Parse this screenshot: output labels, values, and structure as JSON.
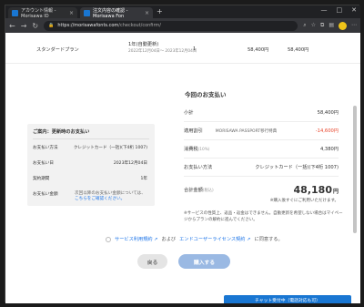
{
  "browser": {
    "tabs": [
      {
        "label": "アカウント情報 - Morisawa ID",
        "close": "×"
      },
      {
        "label": "注文内容の確認 - Morisawa Fon",
        "close": "×"
      }
    ],
    "new_tab": "+",
    "window_controls": [
      "—",
      "□",
      "✕"
    ],
    "url_host": "https://morisawafonts.com",
    "url_path": "/checkout/confirm/"
  },
  "plan_row": {
    "name": "スタンダードプラン",
    "duration": "1年(自動更新)",
    "dates": "2022年12月04日〜 2023年12月04日",
    "quantity": "1",
    "unit_price": "58,400円",
    "subtotal": "58,400円"
  },
  "payment": {
    "title": "今回のお支払い",
    "rows": [
      {
        "label": "小計",
        "sub": "",
        "middle": "",
        "value": "58,400円"
      },
      {
        "label": "適用割引",
        "sub": "",
        "middle": "MORISAWA PASSPORT移行特典",
        "value": "-14,600円"
      },
      {
        "label": "消費税",
        "sub": "(10%)",
        "middle": "",
        "value": "4,380円"
      },
      {
        "label": "お支払い方法",
        "sub": "",
        "middle": "",
        "value": "クレジットカード（一括)(下4桁 1007)"
      }
    ],
    "total_label": "合計金額",
    "total_sub": "(税込)",
    "total_value": "48,180",
    "total_unit": "円",
    "total_note": "※購入後すぐにご利用いただけます。",
    "notice": "※サービスの性質上、返品・返金はできません。自動更新を希望しない場合はマイページからプランの解約に進んでください。"
  },
  "renewal": {
    "title": "ご案内：更新時のお支払い",
    "rows": [
      {
        "label": "お支払い方法",
        "value": "クレジットカード（一括)(下4桁 1007)"
      },
      {
        "label": "お支払い日",
        "value": "2023年12月04日"
      },
      {
        "label": "契約期間",
        "value": "1年"
      },
      {
        "label": "お支払い金額",
        "value": ""
      }
    ],
    "note": "次回以降のお支払い金額については、",
    "note_link": "こちらをご確認ください。"
  },
  "agreement": {
    "link1": "サービス利用規約 ↗",
    "connector": "および",
    "link2": "エンドユーザーライセンス契約 ↗",
    "suffix": "に同意する。"
  },
  "buttons": {
    "back": "戻る",
    "buy": "購入する"
  },
  "chat": "チャット受付中（電話対応も可）",
  "colors": {
    "primary": "#1976d2",
    "discount": "#e8452b",
    "buy_disabled": "#9ab9e3"
  }
}
